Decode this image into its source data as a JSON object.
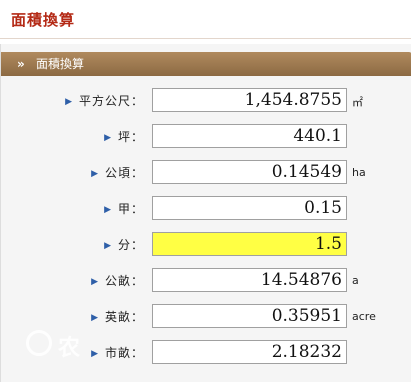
{
  "page": {
    "title": "面積換算"
  },
  "panel": {
    "title": "面積換算",
    "chevron": "»"
  },
  "rows": [
    {
      "label": "平方公尺：",
      "value": "1,454.8755",
      "unit": "㎡",
      "active": false
    },
    {
      "label": "坪：",
      "value": "440.1",
      "unit": "",
      "active": false
    },
    {
      "label": "公頃：",
      "value": "0.14549",
      "unit": "ha",
      "active": false
    },
    {
      "label": "甲：",
      "value": "0.15",
      "unit": "",
      "active": false
    },
    {
      "label": "分：",
      "value": "1.5",
      "unit": "",
      "active": true
    },
    {
      "label": "公畝：",
      "value": "14.54876",
      "unit": "a",
      "active": false
    },
    {
      "label": "英畝：",
      "value": "0.35951",
      "unit": "acre",
      "active": false
    },
    {
      "label": "市畝：",
      "value": "2.18232",
      "unit": "",
      "active": false
    }
  ],
  "bullet_icon": "▶",
  "watermark": {
    "text": "农",
    "icon": "logo-circle-icon"
  },
  "colors": {
    "title": "#b42a16",
    "header": "#9a7650",
    "active_field": "#ffff44",
    "bullet": "#2e5fa8"
  }
}
